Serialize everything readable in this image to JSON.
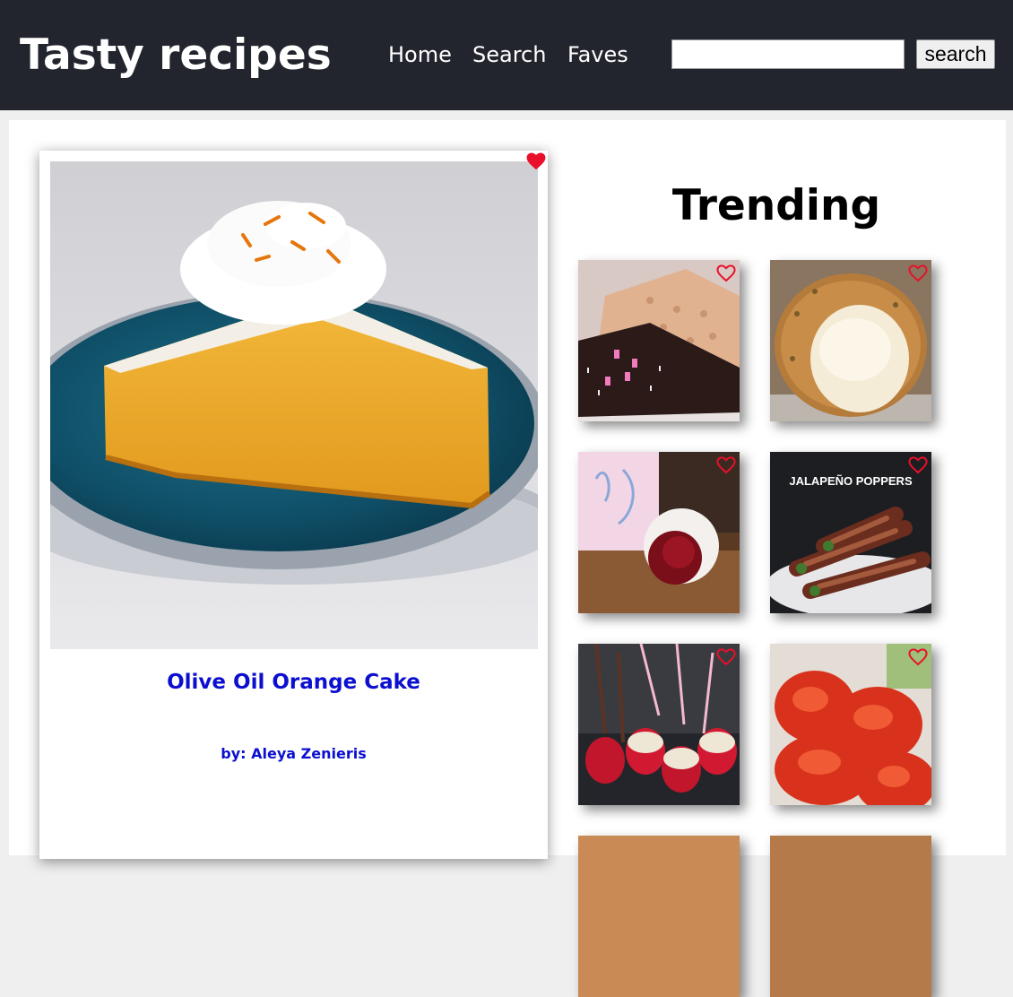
{
  "header": {
    "brand": "Tasty recipes",
    "nav": [
      {
        "label": "Home"
      },
      {
        "label": "Search"
      },
      {
        "label": "Faves"
      }
    ],
    "search": {
      "value": "",
      "placeholder": "",
      "button_label": "search"
    }
  },
  "feature": {
    "title": "Olive Oil Orange Cake",
    "author": "by: Aleya Zenieris",
    "image": "orange-cake-photo",
    "favorited": true
  },
  "trending": {
    "title": "Trending",
    "items": [
      {
        "image": "chocolate-rice-krispie-treat-photo",
        "favorited": false
      },
      {
        "image": "fried-cheese-ball-photo",
        "favorited": false
      },
      {
        "image": "red-velvet-cake-pop-photo",
        "favorited": false
      },
      {
        "image": "jalapeno-poppers-photo",
        "overlay_text": "JALAPEÑO POPPERS",
        "favorited": false
      },
      {
        "image": "oreo-strawberry-pops-photo",
        "favorited": false
      },
      {
        "image": "buffalo-chicken-photo",
        "favorited": false
      }
    ]
  },
  "colors": {
    "header_bg": "#22252d",
    "link": "#0c0fcf",
    "heart": "#e8102a"
  }
}
